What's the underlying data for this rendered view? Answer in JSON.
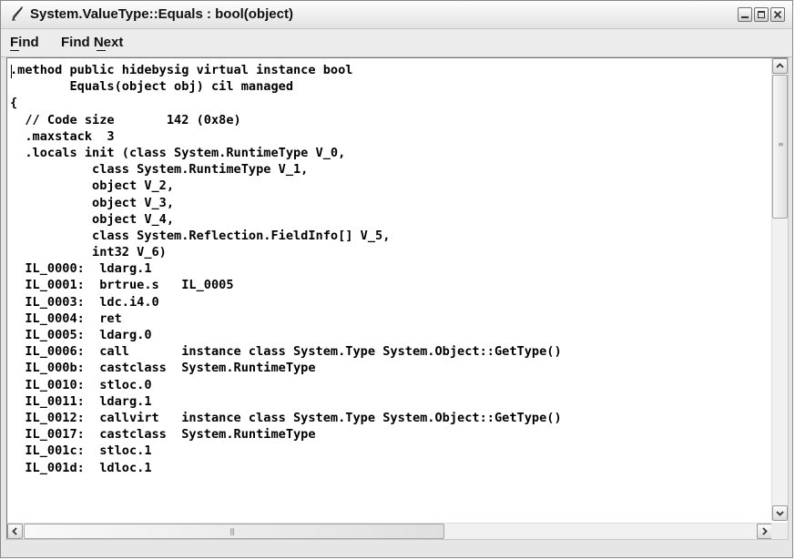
{
  "window": {
    "title": "System.ValueType::Equals : bool(object)",
    "title_icon": "quill-pen-icon",
    "controls": [
      "minimize-icon",
      "maximize-icon",
      "close-icon"
    ]
  },
  "menu": {
    "items": [
      {
        "label": "Find",
        "accel": "F"
      },
      {
        "label": "Find Next",
        "accel": "N"
      }
    ]
  },
  "code": {
    "lines": [
      ".method public hidebysig virtual instance bool",
      "        Equals(object obj) cil managed",
      "{",
      "  // Code size       142 (0x8e)",
      "  .maxstack  3",
      "  .locals init (class System.RuntimeType V_0,",
      "           class System.RuntimeType V_1,",
      "           object V_2,",
      "           object V_3,",
      "           object V_4,",
      "           class System.Reflection.FieldInfo[] V_5,",
      "           int32 V_6)",
      "  IL_0000:  ldarg.1",
      "  IL_0001:  brtrue.s   IL_0005",
      "  IL_0003:  ldc.i4.0",
      "  IL_0004:  ret",
      "  IL_0005:  ldarg.0",
      "  IL_0006:  call       instance class System.Type System.Object::GetType()",
      "  IL_000b:  castclass  System.RuntimeType",
      "  IL_0010:  stloc.0",
      "  IL_0011:  ldarg.1",
      "  IL_0012:  callvirt   instance class System.Type System.Object::GetType()",
      "  IL_0017:  castclass  System.RuntimeType",
      "  IL_001c:  stloc.1",
      "  IL_001d:  ldloc.1"
    ]
  },
  "colors": {
    "window_border": "#8a8a8a",
    "editor_background": "#ffffff",
    "text": "#000000"
  }
}
